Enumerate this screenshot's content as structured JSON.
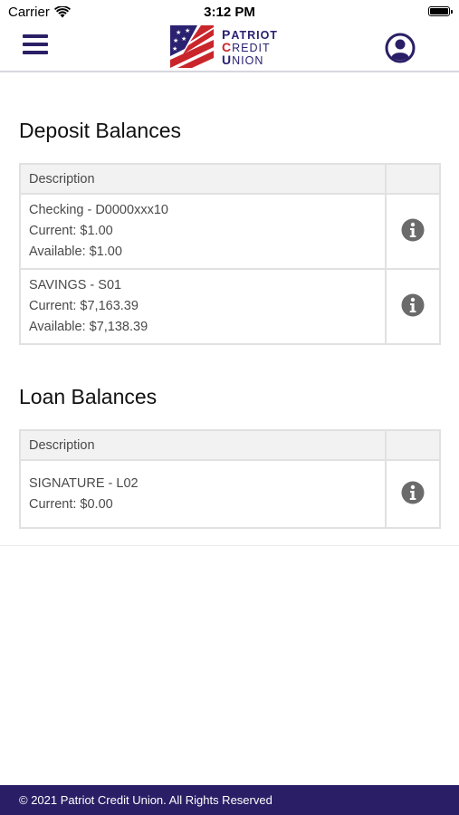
{
  "status_bar": {
    "carrier": "Carrier",
    "time": "3:12 PM"
  },
  "header": {
    "logo_words": [
      "PATRIOT",
      "CREDIT",
      "UNION"
    ],
    "accent_color": "#2a1f66",
    "logo_red": "#c9252b"
  },
  "deposit": {
    "title": "Deposit Balances",
    "header": "Description",
    "rows": [
      {
        "line1": "Checking - D0000xxx10",
        "line2": "Current: $1.00",
        "line3": "Available: $1.00"
      },
      {
        "line1": "SAVINGS - S01",
        "line2": "Current: $7,163.39",
        "line3": "Available: $7,138.39"
      }
    ]
  },
  "loan": {
    "title": "Loan Balances",
    "header": "Description",
    "rows": [
      {
        "line1": "SIGNATURE - L02",
        "line2": "Current: $0.00"
      }
    ]
  },
  "footer": {
    "text": "© 2021 Patriot Credit Union. All Rights Reserved"
  }
}
